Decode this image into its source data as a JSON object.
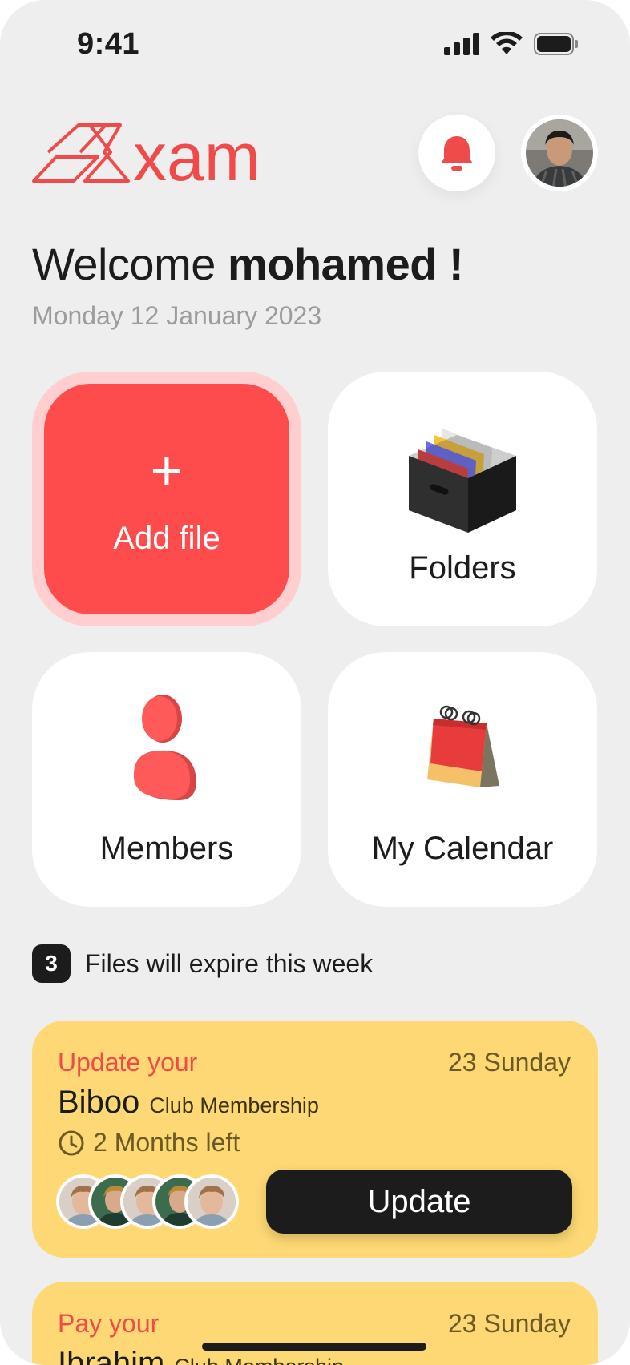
{
  "status_bar": {
    "time": "9:41"
  },
  "header": {
    "logo_text": "xam"
  },
  "welcome": {
    "greeting": "Welcome",
    "name": "mohamed !",
    "date": "Monday 12 January 2023"
  },
  "tiles": {
    "add_file": {
      "icon": "+",
      "label": "Add file"
    },
    "folders": {
      "label": "Folders"
    },
    "members": {
      "label": "Members"
    },
    "calendar": {
      "label": "My Calendar"
    }
  },
  "expiring": {
    "count": "3",
    "text": "Files will expire this week"
  },
  "cards": [
    {
      "verb": "Update your",
      "date": "23 Sunday",
      "name": "Biboo",
      "membership": "Club Membership",
      "time_left": "2 Months left",
      "button": "Update"
    },
    {
      "verb": "Pay your",
      "date": "23 Sunday",
      "name": "Ibrahim",
      "membership": "Club Membership"
    }
  ],
  "colors": {
    "accent_red": "#fe4b4b",
    "card_yellow": "#fdd874",
    "background": "#eeeeee",
    "dark": "#1c1c1c"
  }
}
